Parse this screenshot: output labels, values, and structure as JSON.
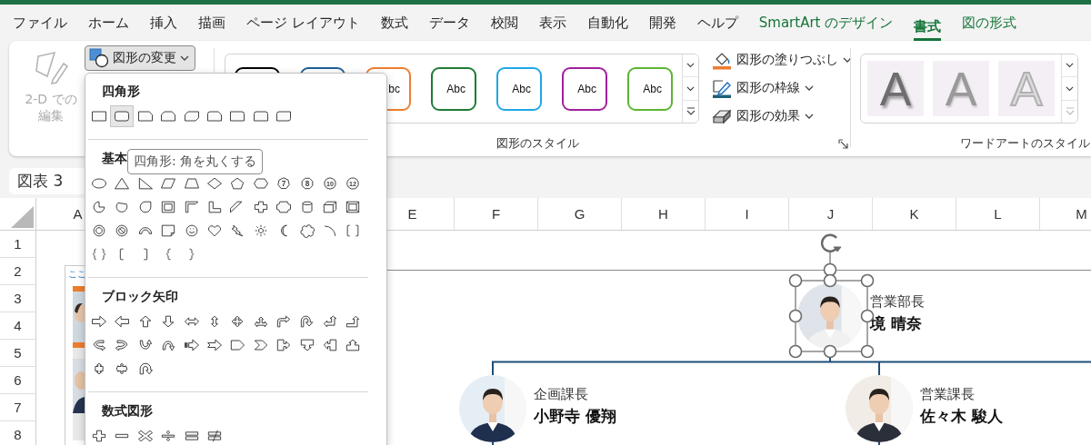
{
  "menu_tabs": [
    {
      "label": "ファイル",
      "kind": "standard",
      "selected": false
    },
    {
      "label": "ホーム",
      "kind": "standard",
      "selected": false
    },
    {
      "label": "挿入",
      "kind": "standard",
      "selected": false
    },
    {
      "label": "描画",
      "kind": "standard",
      "selected": false
    },
    {
      "label": "ページ レイアウト",
      "kind": "standard",
      "selected": false
    },
    {
      "label": "数式",
      "kind": "standard",
      "selected": false
    },
    {
      "label": "データ",
      "kind": "standard",
      "selected": false
    },
    {
      "label": "校閲",
      "kind": "standard",
      "selected": false
    },
    {
      "label": "表示",
      "kind": "standard",
      "selected": false
    },
    {
      "label": "自動化",
      "kind": "standard",
      "selected": false
    },
    {
      "label": "開発",
      "kind": "standard",
      "selected": false
    },
    {
      "label": "ヘルプ",
      "kind": "standard",
      "selected": false
    },
    {
      "label": "SmartArt のデザイン",
      "kind": "contextual",
      "selected": false
    },
    {
      "label": "書式",
      "kind": "contextual",
      "selected": true
    },
    {
      "label": "図の形式",
      "kind": "contextual",
      "selected": false
    }
  ],
  "ribbon": {
    "edit_button": {
      "label_lines": [
        "2-D での",
        "編集"
      ],
      "disabled": true
    },
    "change_shape_button": {
      "label": "図形の変更",
      "pressed": true
    },
    "shape_styles": {
      "label": "図形のスタイル",
      "styles": [
        {
          "color": "#000000"
        },
        {
          "color": "#1f5f96"
        },
        {
          "color": "#ed7d31",
          "label": "bc"
        },
        {
          "color": "#1e7b34",
          "label": "Abc"
        },
        {
          "color": "#1ea7e8",
          "label": "Abc"
        },
        {
          "color": "#a0209a",
          "label": "Abc"
        },
        {
          "color": "#5cb431",
          "label": "Abc"
        }
      ]
    },
    "shape_commands": [
      {
        "label": "図形の塗りつぶし",
        "kind": "fill"
      },
      {
        "label": "図形の枠線",
        "kind": "outline"
      },
      {
        "label": "図形の効果",
        "kind": "effects"
      }
    ],
    "wordart": {
      "label": "ワードアートのスタイル",
      "styles": [
        {
          "label": "A",
          "kind": "shadow"
        },
        {
          "label": "A",
          "kind": "soft"
        },
        {
          "label": "A",
          "kind": "outline"
        }
      ]
    }
  },
  "name_box": {
    "value": "図表 3"
  },
  "sheet": {
    "columns": [
      "A",
      "E",
      "F",
      "G",
      "H",
      "I",
      "J",
      "K",
      "L",
      "M"
    ],
    "rows": [
      "1",
      "2",
      "3",
      "4",
      "5",
      "6",
      "7",
      "8"
    ]
  },
  "text_pane": {
    "text": "ここ"
  },
  "org_chart": {
    "nodes": [
      {
        "title": "営業部長",
        "name": "境 晴奈",
        "selected": true
      },
      {
        "title": "企画課長",
        "name": "小野寺 優翔",
        "selected": false
      },
      {
        "title": "営業課長",
        "name": "佐々木 駿人",
        "selected": false
      }
    ]
  },
  "shape_menu": {
    "groups": [
      {
        "title": "四角形",
        "shapes": [
          {
            "kind": "rectangle",
            "selected": false
          },
          {
            "kind": "rounded-rectangle",
            "selected": true
          },
          {
            "kind": "snip-corner-rectangle",
            "selected": false
          },
          {
            "kind": "snip-same-side-rectangle",
            "selected": false
          },
          {
            "kind": "snip-diagonal-rectangle",
            "selected": false
          },
          {
            "kind": "snip-round-rectangle",
            "selected": false
          },
          {
            "kind": "round-corner-rectangle",
            "selected": false
          },
          {
            "kind": "round-same-side-rectangle",
            "selected": false
          },
          {
            "kind": "round-diagonal-rectangle",
            "selected": false
          }
        ]
      },
      {
        "title": "基本",
        "shapes": [
          {
            "kind": "oval",
            "selected": false
          },
          {
            "kind": "triangle",
            "selected": false
          },
          {
            "kind": "right-triangle",
            "selected": false
          },
          {
            "kind": "parallelogram",
            "selected": false
          },
          {
            "kind": "trapezoid",
            "selected": false
          },
          {
            "kind": "diamond",
            "selected": false
          },
          {
            "kind": "pentagon",
            "selected": false
          },
          {
            "kind": "hexagon",
            "selected": false
          },
          {
            "kind": "heptagon",
            "selected": false,
            "label": "7"
          },
          {
            "kind": "octagon",
            "selected": false,
            "label": "8"
          },
          {
            "kind": "decagon",
            "selected": false,
            "label": "10"
          },
          {
            "kind": "dodecagon",
            "selected": false,
            "label": "12"
          },
          {
            "kind": "pie",
            "selected": false
          },
          {
            "kind": "chord",
            "selected": false
          },
          {
            "kind": "teardrop",
            "selected": false
          },
          {
            "kind": "frame",
            "selected": false
          },
          {
            "kind": "half-frame",
            "selected": false
          },
          {
            "kind": "l-shape",
            "selected": false
          },
          {
            "kind": "diagonal-stripe",
            "selected": false
          },
          {
            "kind": "cross",
            "selected": false
          },
          {
            "kind": "plaque",
            "selected": false
          },
          {
            "kind": "cylinder",
            "selected": false
          },
          {
            "kind": "cube",
            "selected": false
          },
          {
            "kind": "bevel",
            "selected": false
          },
          {
            "kind": "donut",
            "selected": false
          },
          {
            "kind": "no-symbol",
            "selected": false
          },
          {
            "kind": "block-arc",
            "selected": false
          },
          {
            "kind": "folded-corner",
            "selected": false
          },
          {
            "kind": "smiley",
            "selected": false
          },
          {
            "kind": "heart",
            "selected": false
          },
          {
            "kind": "lightning",
            "selected": false
          },
          {
            "kind": "sun",
            "selected": false
          },
          {
            "kind": "moon",
            "selected": false
          },
          {
            "kind": "cloud",
            "selected": false
          },
          {
            "kind": "arc",
            "selected": false
          },
          {
            "kind": "bracket-pair",
            "selected": false
          },
          {
            "kind": "brace-pair",
            "selected": false
          },
          {
            "kind": "left-bracket",
            "selected": false
          },
          {
            "kind": "right-bracket",
            "selected": false
          },
          {
            "kind": "left-brace",
            "selected": false
          },
          {
            "kind": "right-brace",
            "selected": false
          }
        ]
      },
      {
        "title": "ブロック矢印",
        "shapes": [
          {
            "kind": "right-arrow",
            "selected": false
          },
          {
            "kind": "left-arrow",
            "selected": false
          },
          {
            "kind": "up-arrow",
            "selected": false
          },
          {
            "kind": "down-arrow",
            "selected": false
          },
          {
            "kind": "left-right-arrow",
            "selected": false
          },
          {
            "kind": "up-down-arrow",
            "selected": false
          },
          {
            "kind": "quad-arrow",
            "selected": false
          },
          {
            "kind": "left-right-up-arrow",
            "selected": false
          },
          {
            "kind": "bent-arrow",
            "selected": false
          },
          {
            "kind": "u-turn-arrow",
            "selected": false
          },
          {
            "kind": "left-up-arrow",
            "selected": false
          },
          {
            "kind": "bent-up-arrow",
            "selected": false
          },
          {
            "kind": "curved-right-arrow",
            "selected": false
          },
          {
            "kind": "curved-left-arrow",
            "selected": false
          },
          {
            "kind": "curved-up-arrow",
            "selected": false
          },
          {
            "kind": "curved-down-arrow",
            "selected": false
          },
          {
            "kind": "striped-right-arrow",
            "selected": false
          },
          {
            "kind": "notched-right-arrow",
            "selected": false
          },
          {
            "kind": "pentagon-arrow",
            "selected": false
          },
          {
            "kind": "chevron-arrow",
            "selected": false
          },
          {
            "kind": "right-arrow-callout",
            "selected": false
          },
          {
            "kind": "down-arrow-callout",
            "selected": false
          },
          {
            "kind": "left-arrow-callout",
            "selected": false
          },
          {
            "kind": "up-arrow-callout",
            "selected": false
          },
          {
            "kind": "up-down-arrow-callout",
            "selected": false
          },
          {
            "kind": "quad-arrow-callout",
            "selected": false
          },
          {
            "kind": "circular-arrow",
            "selected": false
          }
        ]
      },
      {
        "title": "数式図形",
        "shapes": [
          {
            "kind": "plus",
            "selected": false
          },
          {
            "kind": "minus",
            "selected": false
          },
          {
            "kind": "multiply",
            "selected": false
          },
          {
            "kind": "divide",
            "selected": false
          },
          {
            "kind": "equal",
            "selected": false
          },
          {
            "kind": "not-equal",
            "selected": false
          }
        ]
      }
    ]
  },
  "tooltip": {
    "text": "四角形: 角を丸くする"
  }
}
